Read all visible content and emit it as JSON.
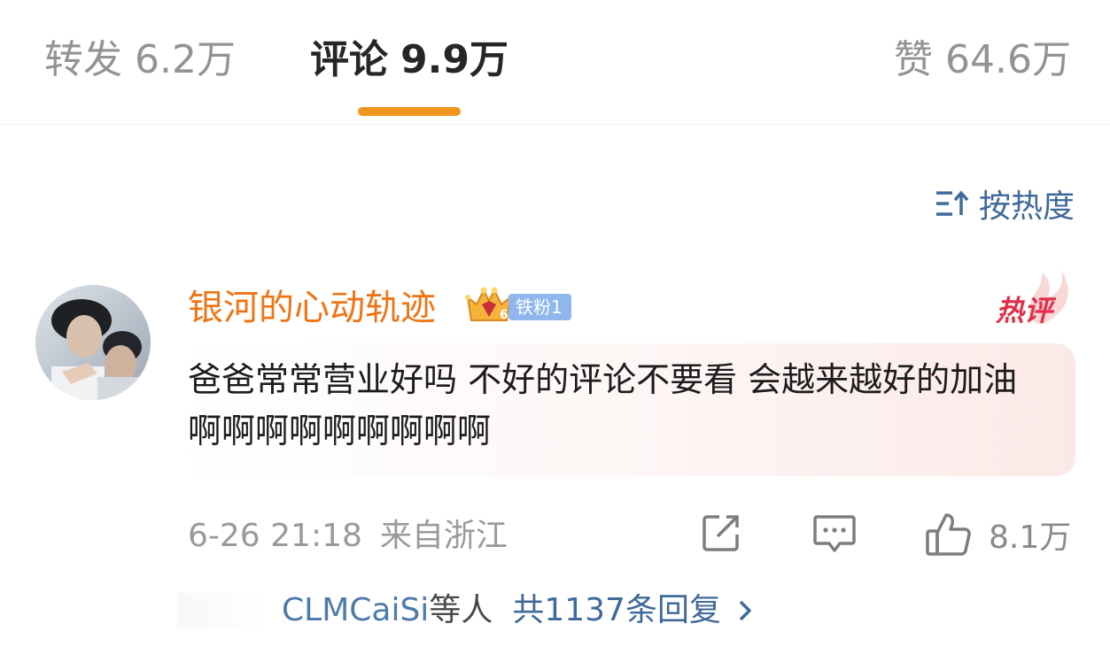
{
  "tabs": {
    "repost": {
      "label": "转发",
      "count": "6.2万"
    },
    "comments": {
      "label": "评论",
      "count": "9.9万"
    },
    "likes": {
      "label": "赞",
      "count": "64.6万"
    }
  },
  "sort": {
    "label": "按热度",
    "icon": "sort-icon"
  },
  "comment": {
    "username": "银河的心动轨迹",
    "fan_badge": "铁粉1",
    "crown_level": "6",
    "hot_label": "热评",
    "text": "爸爸常常营业好吗 不好的评论不要看 会越来越好的加油啊啊啊啊啊啊啊啊啊",
    "date": "6-26 21:18",
    "location": "来自浙江",
    "like_count": "8.1万",
    "replies": {
      "names": "CLMCaiSi",
      "suffix": "等人",
      "count_text": "共1137条回复"
    }
  },
  "colors": {
    "accent": "#f0961e",
    "username": "#ef7414",
    "link": "#3f6a9a",
    "hot": "#e0304a"
  }
}
